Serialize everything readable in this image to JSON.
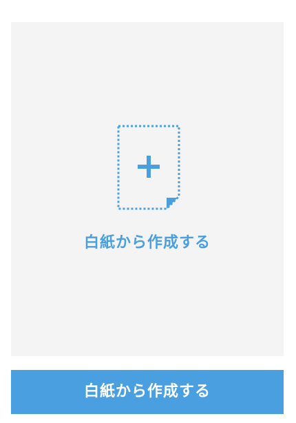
{
  "blank_card": {
    "label": "白紙から作成する",
    "icon": "new-blank-document-icon"
  },
  "create_button": {
    "label": "白紙から作成する"
  },
  "colors": {
    "accent": "#4a9fe0",
    "card_background": "#f4f4f4",
    "button_text": "#ffffff"
  }
}
